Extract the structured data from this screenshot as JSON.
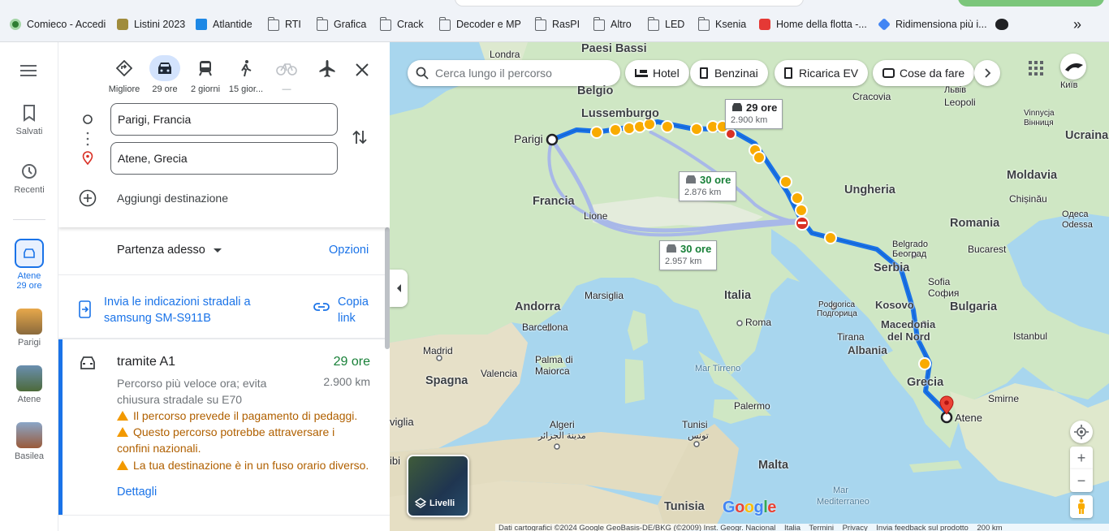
{
  "bookmarks": {
    "items": [
      {
        "label": "Comieco - Accedi",
        "icon": "comieco-icon"
      },
      {
        "label": "Listini 2023",
        "icon": "leaf-icon"
      },
      {
        "label": "Atlantide",
        "icon": "atlantide-icon"
      },
      {
        "label": "RTI",
        "icon": "folder-icon"
      },
      {
        "label": "Grafica",
        "icon": "folder-icon"
      },
      {
        "label": "Crack",
        "icon": "folder-icon"
      },
      {
        "label": "Decoder e MP",
        "icon": "folder-icon"
      },
      {
        "label": "RasPI",
        "icon": "folder-icon"
      },
      {
        "label": "Altro",
        "icon": "folder-icon"
      },
      {
        "label": "LED",
        "icon": "folder-icon"
      },
      {
        "label": "Ksenia",
        "icon": "folder-icon"
      },
      {
        "label": "Home della flotta -...",
        "icon": "fleet-icon"
      },
      {
        "label": "Ridimensiona più i...",
        "icon": "heart-icon"
      }
    ],
    "overflow": "»"
  },
  "rail": {
    "menu_icon": "menu-icon",
    "saved": "Salvati",
    "recent": "Recenti",
    "recent_trip_line1": "Atene",
    "recent_trip_line2": "29 ore",
    "places": [
      "Parigi",
      "Atene",
      "Basilea"
    ]
  },
  "modes": [
    {
      "label": "Migliore",
      "icon": "best-route-icon"
    },
    {
      "label": "29 ore",
      "icon": "car-icon"
    },
    {
      "label": "2 giorni",
      "icon": "train-icon"
    },
    {
      "label": "15 gior...",
      "icon": "walk-icon"
    },
    {
      "label": "—",
      "icon": "bike-icon"
    },
    {
      "label": "",
      "icon": "plane-icon"
    }
  ],
  "directions": {
    "origin": "Parigi, Francia",
    "destination": "Atene, Grecia",
    "add_destination": "Aggiungi destinazione",
    "depart": "Partenza adesso",
    "options": "Opzioni",
    "send_to_phone": "Invia le indicazioni stradali a samsung SM-S911B",
    "copy_link": "Copia link"
  },
  "route": {
    "via": "tramite A1",
    "time": "29 ore",
    "desc": "Percorso più veloce ora; evita chiusura stradale su E70",
    "distance": "2.900 km",
    "warnings": [
      "Il percorso prevede il pagamento di pedaggi.",
      "Questo percorso potrebbe attraversare i confini nazionali.",
      "La tua destinazione è in un fuso orario diverso."
    ],
    "details": "Dettagli"
  },
  "map": {
    "search_placeholder": "Cerca lungo il percorso",
    "chips": [
      "Hotel",
      "Benzinai",
      "Ricarica EV",
      "Cose da fare"
    ],
    "route_boxes": [
      {
        "time": "29 ore",
        "dist": "2.900 km"
      },
      {
        "time": "30 ore",
        "dist": "2.876 km"
      },
      {
        "time": "30 ore",
        "dist": "2.957 km"
      }
    ],
    "labels": {
      "london": "Londra",
      "paesi_bassi": "Paesi Bassi",
      "belgio": "Belgio",
      "lussemburgo": "Lussemburgo",
      "parigi": "Parigi",
      "francia": "Francia",
      "lione": "Lione",
      "marsiglia": "Marsiglia",
      "andorra": "Andorra",
      "barcellona": "Barcellona",
      "madrid": "Madrid",
      "spagna": "Spagna",
      "valencia": "Valencia",
      "palma": "Palma di Maiorca",
      "algeri": "Algeri",
      "algeri_ar": "مدينة الجزائر",
      "tunisi": "Tunisi",
      "tunisi_ar": "تونس",
      "tunisia": "Tunisia",
      "malta": "Malta",
      "palermo": "Palermo",
      "italia": "Italia",
      "roma": "Roma",
      "mar_tirreno": "Mar Tirreno",
      "mar_med1": "Mar",
      "mar_med2": "Mediterraneo",
      "ungheria": "Ungheria",
      "romania": "Romania",
      "bucarest": "Bucarest",
      "moldavia": "Moldavia",
      "chisinau": "Chișinău",
      "odessa1": "Одеса",
      "odessa2": "Odessa",
      "ucraina": "Ucraina",
      "cracovia": "Cracovia",
      "leopoli1": "Львів",
      "leopoli2": "Leopoli",
      "vinnycia1": "Vinnycja",
      "vinnycia2": "Вінниця",
      "kyiv": "Київ",
      "serbia": "Serbia",
      "belgrado1": "Belgrado",
      "belgrado2": "Београд",
      "sofia1": "Sofia",
      "sofia2": "София",
      "bulgaria": "Bulgaria",
      "kosovo": "Kosovo",
      "podgorica1": "Podgorica",
      "podgorica2": "Подгорица",
      "tirana": "Tirana",
      "albania": "Albania",
      "macedonia1": "Macedonia",
      "macedonia2": "del Nord",
      "istanbul": "Istanbul",
      "grecia": "Grecia",
      "smirne": "Smirne",
      "atene": "Atene",
      "viglia": "viglia",
      "ibi": "ibi"
    },
    "layers": "Livelli",
    "footer": "Dati cartografici ©2024 Google GeoBasis-DE/BKG (©2009) Inst. Geogr. Nacional    Italia    Termini    Privacy    Invia feedback sul prodotto    200 km",
    "google": "Google",
    "colors": {
      "route": "#1a73e8",
      "alt_route": "#a8b8e8",
      "water": "#a8d6ee",
      "land": "#cfe7c4"
    }
  }
}
